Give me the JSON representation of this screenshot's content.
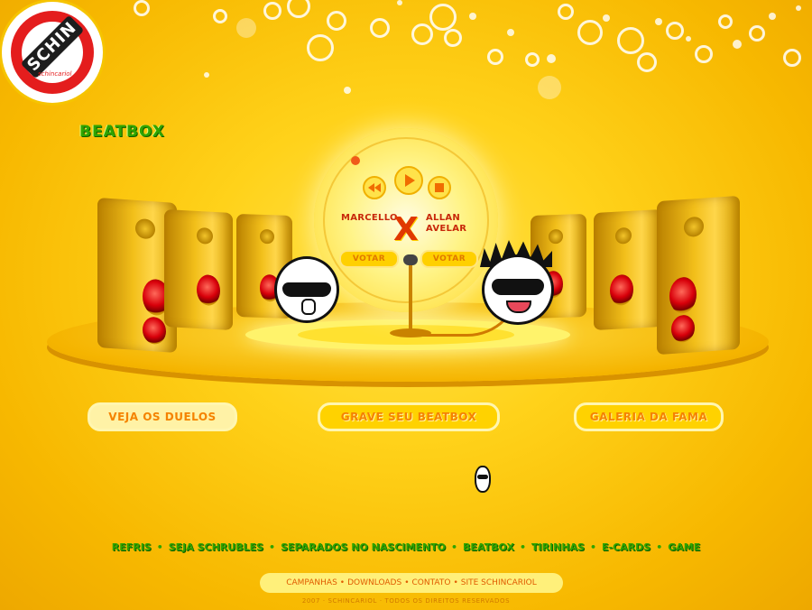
{
  "brand": {
    "logo_text": "SCHIN",
    "logo_tagline": "schincariol"
  },
  "page_title": "BEATBOX",
  "player": {
    "controls": [
      "rewind-icon",
      "play-icon",
      "stop-icon"
    ],
    "left_name": "MARCELLO",
    "vs": "X",
    "right_name": "ALLAN AVELAR",
    "vote_left": "VOTAR",
    "vote_right": "VOTAR"
  },
  "actions": {
    "duelos": "VEJA OS DUELOS",
    "grave": "GRAVE SEU BEATBOX",
    "galeria": "GALERIA DA FAMA"
  },
  "main_nav": [
    "REFRIS",
    "SEJA SCHRUBLES",
    "SEPARADOS NO NASCIMENTO",
    "BEATBOX",
    "TIRINHAS",
    "E-CARDS",
    "GAME"
  ],
  "main_nav_separator": "•",
  "sub_nav": [
    "CAMPANHAS",
    "DOWNLOADS",
    "CONTATO",
    "SITE SCHINCARIOL"
  ],
  "sub_nav_separator": "•",
  "copyright": "2007 · SCHINCARIOL · TODOS OS DIREITOS RESERVADOS",
  "colors": {
    "background": "#ffd21a",
    "nav_green": "#2fa400",
    "button_text": "#f58200",
    "accent_red": "#e41d1d"
  }
}
